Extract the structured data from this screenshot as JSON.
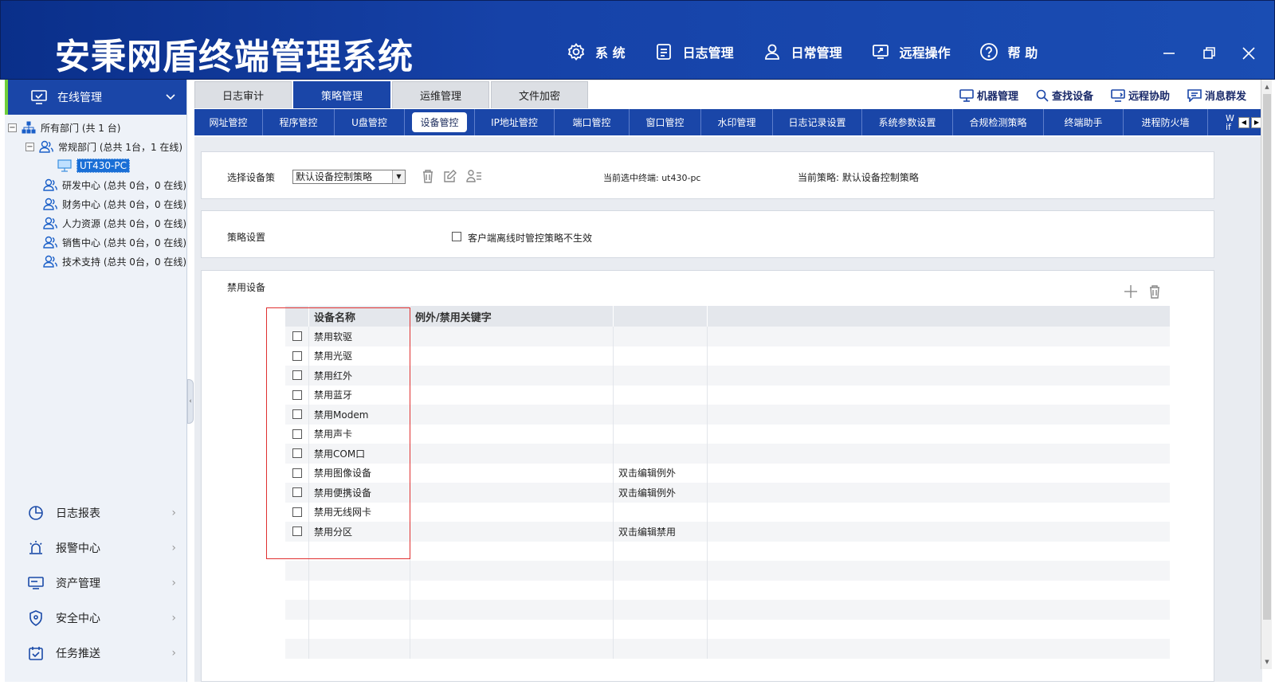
{
  "app": {
    "title": "安秉网盾终端管理系统"
  },
  "top_nav": [
    {
      "label": "系 统",
      "icon": "gear-icon"
    },
    {
      "label": "日志管理",
      "icon": "document-icon"
    },
    {
      "label": "日常管理",
      "icon": "user-icon"
    },
    {
      "label": "远程操作",
      "icon": "remote-icon"
    },
    {
      "label": "帮 助",
      "icon": "help-icon"
    }
  ],
  "sidebar": {
    "header": "在线管理",
    "tree": {
      "root": "所有部门 (共 1 台)",
      "groups": [
        {
          "label": "常规部门 (总共 1台，1 在线)",
          "expanded": true,
          "children": [
            "UT430-PC"
          ]
        },
        {
          "label": "研发中心 (总共 0台，0 在线)"
        },
        {
          "label": "财务中心 (总共 0台，0 在线)"
        },
        {
          "label": "人力资源 (总共 0台，0 在线)"
        },
        {
          "label": "销售中心 (总共 0台，0 在线)"
        },
        {
          "label": "技术支持 (总共 0台，0 在线)"
        }
      ]
    },
    "menu": [
      {
        "label": "日志报表",
        "icon": "pie-chart-icon"
      },
      {
        "label": "报警中心",
        "icon": "alarm-icon"
      },
      {
        "label": "资产管理",
        "icon": "monitor-icon"
      },
      {
        "label": "安全中心",
        "icon": "shield-icon"
      },
      {
        "label": "任务推送",
        "icon": "calendar-check-icon"
      }
    ]
  },
  "main_tabs": [
    "日志审计",
    "策略管理",
    "运维管理",
    "文件加密"
  ],
  "active_main_tab": "策略管理",
  "tools": [
    {
      "label": "机器管理",
      "icon": "computer-icon"
    },
    {
      "label": "查找设备",
      "icon": "search-icon"
    },
    {
      "label": "远程协助",
      "icon": "remote-assist-icon"
    },
    {
      "label": "消息群发",
      "icon": "message-icon"
    }
  ],
  "subnav": {
    "items": [
      "网址管控",
      "程序管控",
      "U盘管控",
      "设备管控",
      "IP地址管控",
      "端口管控",
      "窗口管控",
      "水印管理",
      "日志记录设置",
      "系统参数设置",
      "合规检测策略",
      "终端助手",
      "进程防火墙"
    ],
    "active": "设备管控",
    "overflow_label": "W if"
  },
  "policy_select": {
    "label": "选择设备策",
    "value": "默认设备控制策略",
    "current_terminal": "当前选中终端: ut430-pc",
    "current_policy": "当前策略: 默认设备控制策略"
  },
  "policy_settings": {
    "label": "策略设置",
    "offline_checkbox": "客户端离线时管控策略不生效"
  },
  "disabled_devices": {
    "label": "禁用设备",
    "columns": [
      "设备名称",
      "例外/禁用关键字",
      ""
    ],
    "rows": [
      {
        "name": "禁用软驱",
        "keyword": "",
        "note": ""
      },
      {
        "name": "禁用光驱",
        "keyword": "",
        "note": ""
      },
      {
        "name": "禁用红外",
        "keyword": "",
        "note": ""
      },
      {
        "name": "禁用蓝牙",
        "keyword": "",
        "note": ""
      },
      {
        "name": "禁用Modem",
        "keyword": "",
        "note": ""
      },
      {
        "name": "禁用声卡",
        "keyword": "",
        "note": ""
      },
      {
        "name": "禁用COM口",
        "keyword": "",
        "note": ""
      },
      {
        "name": "禁用图像设备",
        "keyword": "",
        "note": "双击编辑例外"
      },
      {
        "name": "禁用便携设备",
        "keyword": "",
        "note": "双击编辑例外"
      },
      {
        "name": "禁用无线网卡",
        "keyword": "",
        "note": ""
      },
      {
        "name": "禁用分区",
        "keyword": "",
        "note": "双击编辑禁用"
      }
    ],
    "empty_rows": 6
  },
  "colors": {
    "header_bg": "#1642a8",
    "accent": "#1a46a8",
    "highlight": "#e03030",
    "sidebar_indicator": "#6fcf3a"
  }
}
